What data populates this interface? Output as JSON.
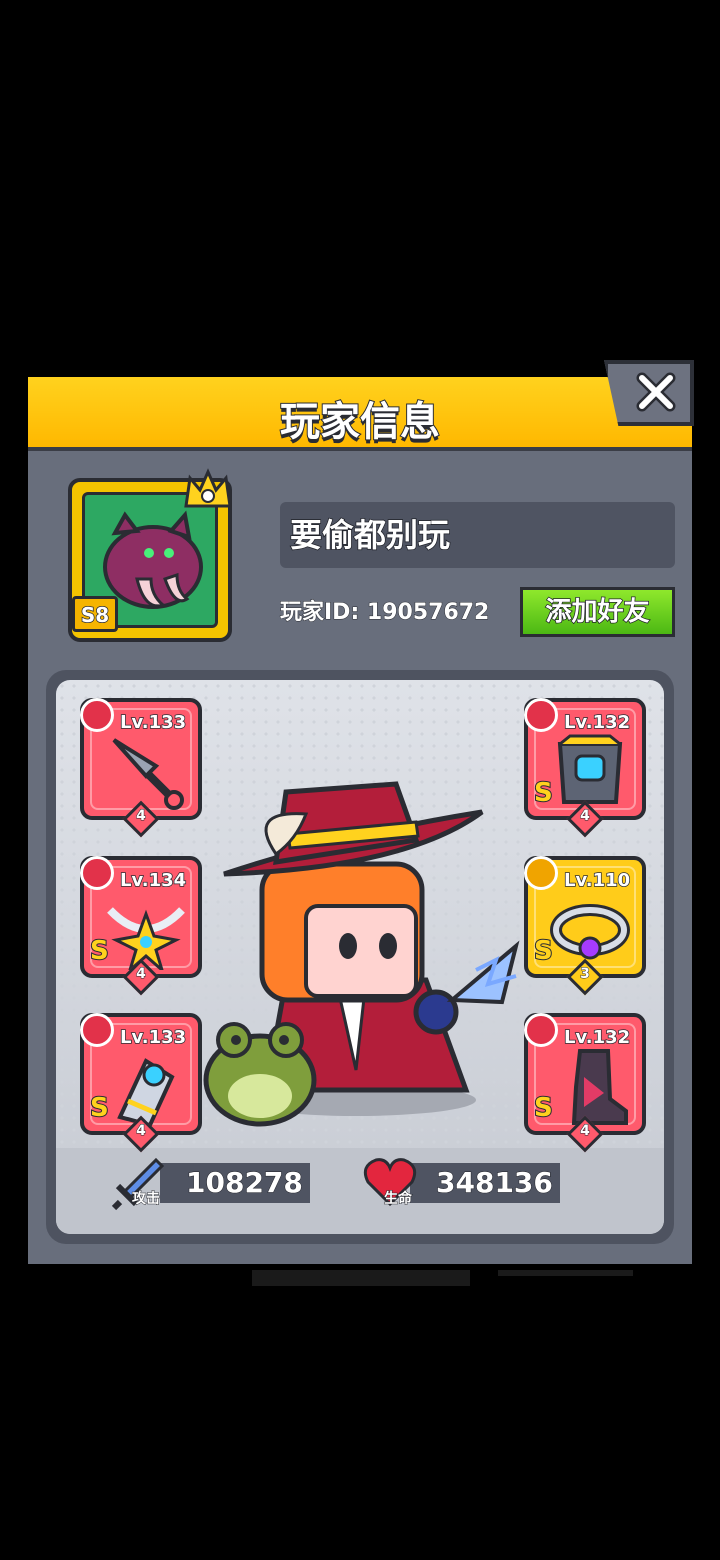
{
  "dialog": {
    "title": "玩家信息",
    "close_icon": "close-icon"
  },
  "profile": {
    "season_badge": "S8",
    "name": "要偷都别玩",
    "player_id": "玩家ID: 19057672",
    "add_friend_label": "添加好友"
  },
  "equipment": {
    "left": [
      {
        "slot": "weapon",
        "icon": "sword-icon",
        "level": "Lv.133",
        "grade": "",
        "stars": "4",
        "item": "kunai-icon"
      },
      {
        "slot": "necklace",
        "icon": "necklace-icon",
        "level": "Lv.134",
        "grade": "S",
        "stars": "4",
        "item": "star-necklace-icon"
      },
      {
        "slot": "gloves",
        "icon": "glove-icon",
        "level": "Lv.133",
        "grade": "S",
        "stars": "4",
        "item": "gauntlet-icon"
      }
    ],
    "right": [
      {
        "slot": "armor",
        "icon": "armor-icon",
        "level": "Lv.132",
        "grade": "S",
        "stars": "4",
        "item": "chest-armor-icon"
      },
      {
        "slot": "belt",
        "icon": "belt-icon",
        "level": "Lv.110",
        "grade": "S",
        "stars": "3",
        "item": "belt-ring-icon"
      },
      {
        "slot": "boots",
        "icon": "boot-icon",
        "level": "Lv.132",
        "grade": "S",
        "stars": "4",
        "item": "armored-boot-icon"
      }
    ]
  },
  "stats": {
    "attack_label": "攻击",
    "attack_value": "108278",
    "hp_label": "生命",
    "hp_value": "348136"
  },
  "colors": {
    "header": "#ffc400",
    "panel": "#686e7c",
    "slot_red": "#ff5a6c",
    "slot_gold": "#ffcc1a",
    "friend_button": "#6fd41e"
  }
}
